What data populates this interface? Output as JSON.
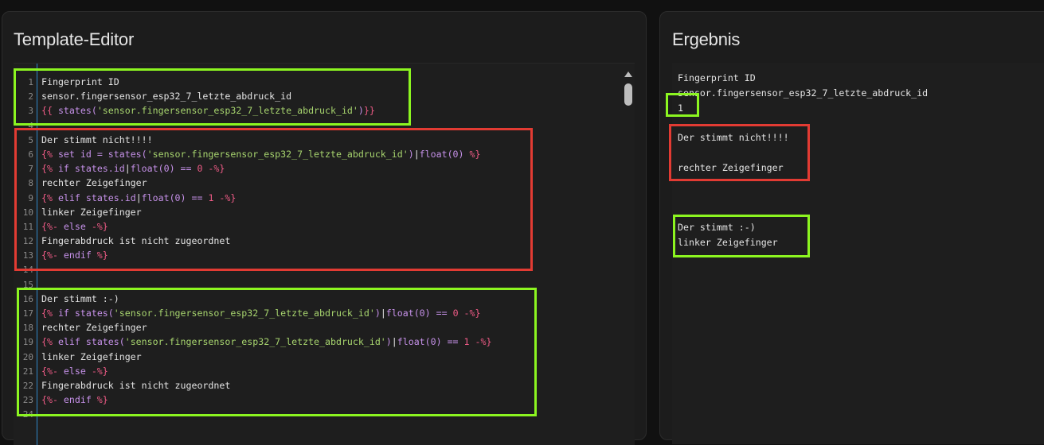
{
  "editor": {
    "title": "Template-Editor",
    "lines": [
      {
        "n": "1",
        "p": [
          {
            "t": "Fingerprint ID"
          }
        ]
      },
      {
        "n": "2",
        "p": [
          {
            "t": "sensor.fingersensor_esp32_7_letzte_abdruck_id"
          }
        ]
      },
      {
        "n": "3",
        "p": [
          {
            "t": "{{ ",
            "c": "j"
          },
          {
            "t": "states(",
            "c": "k"
          },
          {
            "t": "'sensor.fingersensor_esp32_7_letzte_abdruck_id'",
            "c": "s"
          },
          {
            "t": ")",
            "c": "k"
          },
          {
            "t": "}}",
            "c": "j"
          }
        ]
      },
      {
        "n": "4",
        "p": [
          {
            "t": ""
          }
        ]
      },
      {
        "n": "5",
        "p": [
          {
            "t": "Der stimmt nicht!!!!"
          }
        ]
      },
      {
        "n": "6",
        "p": [
          {
            "t": "{% ",
            "c": "j"
          },
          {
            "t": "set id = states(",
            "c": "k"
          },
          {
            "t": "'sensor.fingersensor_esp32_7_letzte_abdruck_id'",
            "c": "s"
          },
          {
            "t": ")",
            "c": "k"
          },
          {
            "t": "|",
            "c": "bar"
          },
          {
            "t": "float(0) ",
            "c": "k"
          },
          {
            "t": "%}",
            "c": "j"
          }
        ]
      },
      {
        "n": "7",
        "p": [
          {
            "t": "{% ",
            "c": "j"
          },
          {
            "t": "if states.id",
            "c": "k"
          },
          {
            "t": "|",
            "c": "bar"
          },
          {
            "t": "float(0) == ",
            "c": "k"
          },
          {
            "t": "0",
            "c": "n"
          },
          {
            "t": " -%}",
            "c": "j"
          }
        ]
      },
      {
        "n": "8",
        "p": [
          {
            "t": "rechter Zeigefinger"
          }
        ]
      },
      {
        "n": "9",
        "p": [
          {
            "t": "{% ",
            "c": "j"
          },
          {
            "t": "elif states.id",
            "c": "k"
          },
          {
            "t": "|",
            "c": "bar"
          },
          {
            "t": "float(0) == ",
            "c": "k"
          },
          {
            "t": "1",
            "c": "n"
          },
          {
            "t": " -%}",
            "c": "j"
          }
        ]
      },
      {
        "n": "10",
        "p": [
          {
            "t": "linker Zeigefinger"
          }
        ]
      },
      {
        "n": "11",
        "p": [
          {
            "t": "{%- ",
            "c": "j"
          },
          {
            "t": "else",
            "c": "k"
          },
          {
            "t": " -%}",
            "c": "j"
          }
        ]
      },
      {
        "n": "12",
        "p": [
          {
            "t": "Fingerabdruck ist nicht zugeordnet"
          }
        ]
      },
      {
        "n": "13",
        "p": [
          {
            "t": "{%- ",
            "c": "j"
          },
          {
            "t": "endif",
            "c": "k"
          },
          {
            "t": " %}",
            "c": "j"
          }
        ]
      },
      {
        "n": "14",
        "p": [
          {
            "t": ""
          }
        ]
      },
      {
        "n": "15",
        "p": [
          {
            "t": ""
          }
        ]
      },
      {
        "n": "16",
        "p": [
          {
            "t": "Der stimmt :-)"
          }
        ]
      },
      {
        "n": "17",
        "p": [
          {
            "t": "{% ",
            "c": "j"
          },
          {
            "t": "if states(",
            "c": "k"
          },
          {
            "t": "'sensor.fingersensor_esp32_7_letzte_abdruck_id'",
            "c": "s"
          },
          {
            "t": ")",
            "c": "k"
          },
          {
            "t": "|",
            "c": "bar"
          },
          {
            "t": "float(0) == ",
            "c": "k"
          },
          {
            "t": "0",
            "c": "n"
          },
          {
            "t": " -%}",
            "c": "j"
          }
        ]
      },
      {
        "n": "18",
        "p": [
          {
            "t": "rechter Zeigefinger"
          }
        ]
      },
      {
        "n": "19",
        "p": [
          {
            "t": "{% ",
            "c": "j"
          },
          {
            "t": "elif states(",
            "c": "k"
          },
          {
            "t": "'sensor.fingersensor_esp32_7_letzte_abdruck_id'",
            "c": "s"
          },
          {
            "t": ")",
            "c": "k"
          },
          {
            "t": "|",
            "c": "bar"
          },
          {
            "t": "float(0) == ",
            "c": "k"
          },
          {
            "t": "1",
            "c": "n"
          },
          {
            "t": " -%}",
            "c": "j"
          }
        ]
      },
      {
        "n": "20",
        "p": [
          {
            "t": "linker Zeigefinger"
          }
        ]
      },
      {
        "n": "21",
        "p": [
          {
            "t": "{%- ",
            "c": "j"
          },
          {
            "t": "else",
            "c": "k"
          },
          {
            "t": " -%}",
            "c": "j"
          }
        ]
      },
      {
        "n": "22",
        "p": [
          {
            "t": "Fingerabdruck ist nicht zugeordnet"
          }
        ]
      },
      {
        "n": "23",
        "p": [
          {
            "t": "{%- ",
            "c": "j"
          },
          {
            "t": "endif",
            "c": "k"
          },
          {
            "t": " %}",
            "c": "j"
          }
        ]
      },
      {
        "n": "24",
        "p": [
          {
            "t": ""
          }
        ]
      }
    ]
  },
  "result": {
    "title": "Ergebnis",
    "lines": [
      "Fingerprint ID",
      "sensor.fingersensor_esp32_7_letzte_abdruck_id",
      "1",
      "",
      "Der stimmt nicht!!!!",
      "",
      "rechter Zeigefinger",
      "",
      "",
      "",
      "Der stimmt :-)",
      "linker Zeigefinger"
    ]
  },
  "colors": {
    "annotation_ok": "#8cf520",
    "annotation_wrong": "#e23b33",
    "jinja_delimiter": "#ef5b86",
    "jinja_keyword": "#c691e9",
    "string": "#a7d46e"
  }
}
